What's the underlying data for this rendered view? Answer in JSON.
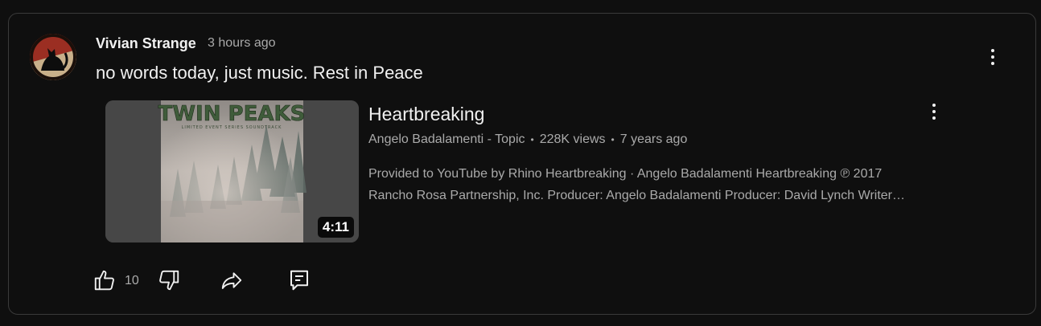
{
  "comment": {
    "author": "Vivian Strange",
    "timestamp": "3 hours ago",
    "text": "no words today, just music. Rest in Peace",
    "like_count": "10"
  },
  "video": {
    "title": "Heartbreaking",
    "channel": "Angelo Badalamenti - Topic",
    "views": "228K views",
    "age": "7 years ago",
    "description_line1": "Provided to YouTube by Rhino Heartbreaking · Angelo Badalamenti Heartbreaking ℗ 2017",
    "description_line2": "Rancho Rosa Partnership, Inc. Producer: Angelo Badalamenti Producer: David Lynch Writer…",
    "duration": "4:11",
    "thumbnail_title": "TWIN PEAKS",
    "thumbnail_subtitle": "LIMITED EVENT SERIES SOUNDTRACK"
  },
  "icons": {
    "avatar": "black-cat-avatar",
    "more": "more-vert-icon",
    "like": "thumb-up-icon",
    "dislike": "thumb-down-icon",
    "share": "share-icon",
    "reply": "reply-icon"
  },
  "colors": {
    "background": "#0f0f0f",
    "border": "#3a3a3a",
    "primary_text": "#f1f1f1",
    "secondary_text": "#aaaaaa"
  }
}
